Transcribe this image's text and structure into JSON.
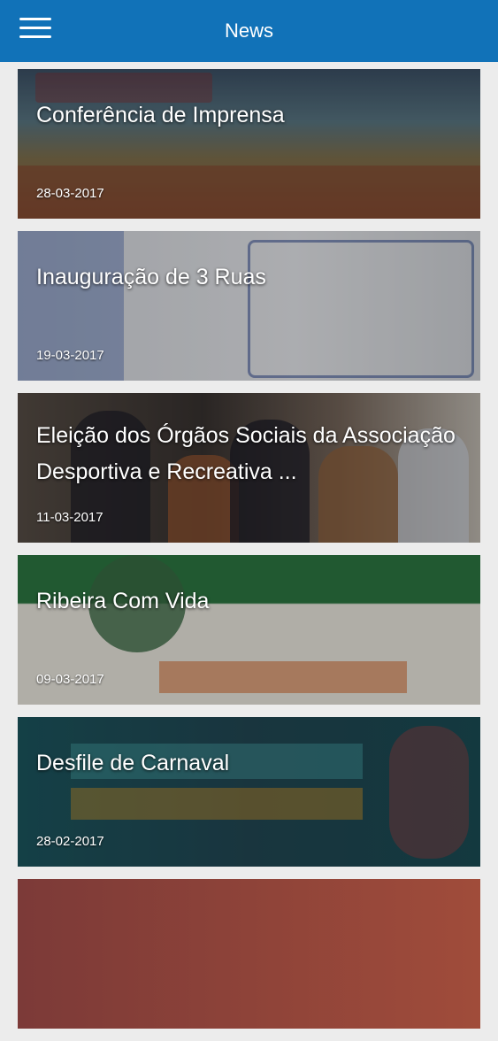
{
  "header": {
    "title": "News",
    "menu_icon": "hamburger-menu-icon"
  },
  "news": [
    {
      "title": "Conferência de Imprensa",
      "date": "28-03-2017"
    },
    {
      "title": "Inauguração de 3 Ruas",
      "date": "19-03-2017"
    },
    {
      "title": "Eleição dos Órgãos Sociais da Associação Desportiva e Recreativa ...",
      "date": "11-03-2017"
    },
    {
      "title": "Ribeira Com Vida",
      "date": "09-03-2017"
    },
    {
      "title": "Desfile de Carnaval",
      "date": "28-02-2017"
    }
  ],
  "colors": {
    "header_bg": "#1172b8",
    "page_bg": "#ececec"
  }
}
